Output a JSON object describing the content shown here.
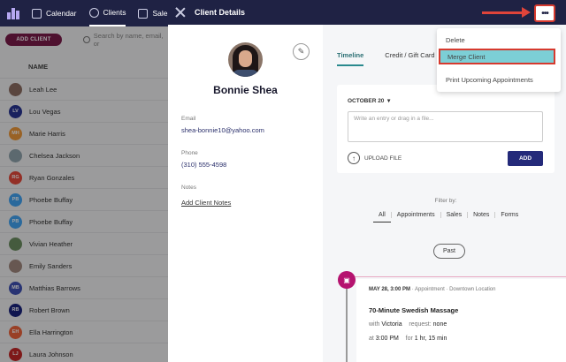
{
  "topnav": {
    "items": [
      {
        "label": "Calendar",
        "icon": "calendar-icon"
      },
      {
        "label": "Clients",
        "icon": "clients-icon"
      },
      {
        "label": "Sale",
        "icon": "sales-tag-icon"
      }
    ]
  },
  "clients": {
    "add_label": "ADD CLIENT",
    "search_placeholder": "Search by name, email, or",
    "column_header": "NAME",
    "rows": [
      {
        "name": "Leah Lee",
        "initials": "",
        "color": "#8d6e63"
      },
      {
        "name": "Lou Vegas",
        "initials": "LV",
        "color": "#283593"
      },
      {
        "name": "Marie Harris",
        "initials": "MH",
        "color": "#ef9a3a"
      },
      {
        "name": "Chelsea Jackson",
        "initials": "",
        "color": "#90a4ae"
      },
      {
        "name": "Ryan Gonzales",
        "initials": "RG",
        "color": "#e64a3c"
      },
      {
        "name": "Phoebe Buffay",
        "initials": "PB",
        "color": "#42a5f5"
      },
      {
        "name": "Phoebe Buffay",
        "initials": "PB",
        "color": "#42a5f5"
      },
      {
        "name": "Vivian Heather",
        "initials": "",
        "color": "#6d8f62"
      },
      {
        "name": "Emily Sanders",
        "initials": "",
        "color": "#a1887f"
      },
      {
        "name": "Matthias Barrows",
        "initials": "MB",
        "color": "#3f51b5"
      },
      {
        "name": "Robert Brown",
        "initials": "RB",
        "color": "#1a237e"
      },
      {
        "name": "Ella Harrington",
        "initials": "EH",
        "color": "#f0643c"
      },
      {
        "name": "Laura Johnson",
        "initials": "LJ",
        "color": "#c62828"
      }
    ]
  },
  "panel": {
    "title": "Client Details",
    "more_label": "•••"
  },
  "profile": {
    "name": "Bonnie Shea",
    "email_label": "Email",
    "email": "shea-bonnie10@yahoo.com",
    "phone_label": "Phone",
    "phone": "(310) 555-4598",
    "notes_label": "Notes",
    "add_notes": "Add Client Notes"
  },
  "tabs": [
    {
      "label": "Timeline",
      "active": true
    },
    {
      "label": "Credit / Gift Card",
      "active": false
    }
  ],
  "entry": {
    "date": "OCTOBER 20",
    "placeholder": "Write an entry or drag in a file...",
    "upload_label": "UPLOAD FILE",
    "add_label": "ADD"
  },
  "filter": {
    "label": "Filter by:",
    "options": [
      "All",
      "Appointments",
      "Sales",
      "Notes",
      "Forms"
    ],
    "active": "All"
  },
  "past_label": "Past",
  "appointment": {
    "date": "MAY 28, 3:00 PM",
    "type": "Appointment",
    "location": "Downtown Location",
    "separator": "·",
    "title": "70-Minute Swedish Massage",
    "with_prefix": "with",
    "staff": "Victoria",
    "request_prefix": "request:",
    "request": "none",
    "at_prefix": "at",
    "time": "3:00 PM",
    "for_prefix": "for",
    "duration": "1 hr, 15 min"
  },
  "menu": {
    "items": [
      "Delete",
      "Merge Client",
      "Print Upcoming Appointments"
    ],
    "highlighted": "Merge Client"
  },
  "colors": {
    "navy": "#1f2244",
    "accent_teal": "#2a8a8e",
    "add_button": "#242a7a",
    "add_client": "#7a1b4a",
    "timeline_icon": "#b5136f",
    "highlight": "#7ccfd6",
    "annotation_red": "#d63a2f"
  }
}
